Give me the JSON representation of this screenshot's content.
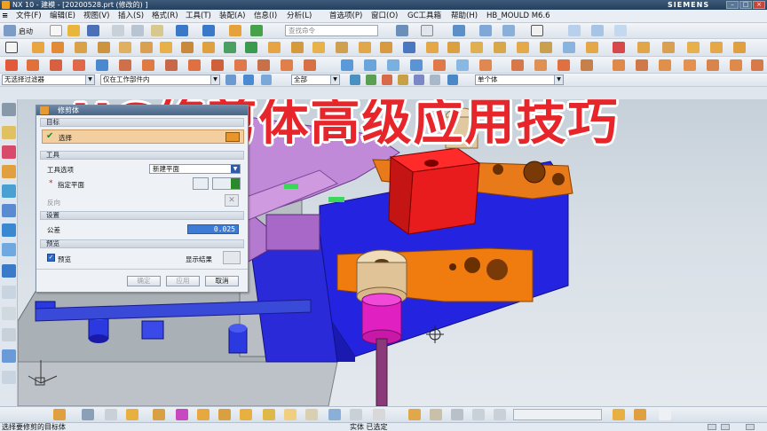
{
  "window": {
    "title": "NX 10 - 建模 - [20200528.prt  (修改的) ]",
    "brand": "SIEMENS"
  },
  "menubar": {
    "items": [
      "文件(F)",
      "编辑(E)",
      "视图(V)",
      "插入(S)",
      "格式(R)",
      "工具(T)",
      "装配(A)",
      "信息(I)",
      "分析(L)",
      "首选项(P)",
      "窗口(O)",
      "GC工具箱",
      "帮助(H)",
      "HB_MOULD M6.6"
    ]
  },
  "toolbar": {
    "start_label": "启动",
    "search_placeholder": "查找命令"
  },
  "selection_bar": {
    "filter_value": "无选择过滤器",
    "scope_value": "仅在工作部件内",
    "all_value": "全部",
    "body_value": "单个体"
  },
  "headline": "UG修剪体高级应用技巧",
  "dialog": {
    "title": "修剪体",
    "target_section": "目标",
    "target_select_label": "选择",
    "tool_section": "工具",
    "tool_option_label": "工具选项",
    "tool_option_value": "新建平面",
    "specify_plane_label": "指定平面",
    "reverse_label": "反向",
    "settings_section": "设置",
    "tolerance_label": "公差",
    "tolerance_value": "0.025",
    "preview_section": "预览",
    "preview_label": "预览",
    "show_result_label": "显示结果",
    "ok_label": "确定",
    "apply_label": "应用",
    "cancel_label": "取消"
  },
  "status": {
    "prompt": "选择要修剪的目标体",
    "info": "实体 已选定"
  },
  "colors": {
    "headline": "#e6262a",
    "titlebar": "#2f4a69",
    "graphics_bg": "#d2dae2"
  }
}
